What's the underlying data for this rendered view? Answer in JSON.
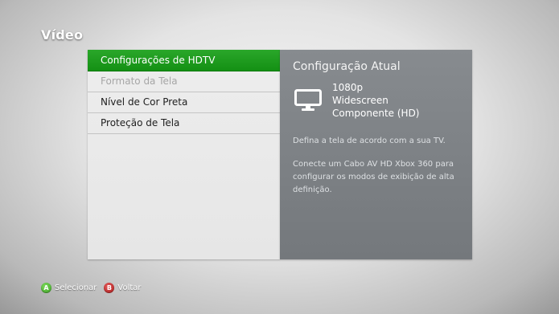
{
  "header": {
    "title": "Vídeo"
  },
  "menu": {
    "items": [
      {
        "label": "Configurações de HDTV",
        "state": "selected"
      },
      {
        "label": "Formato da Tela",
        "state": "disabled"
      },
      {
        "label": "Nível de Cor Preta",
        "state": "normal"
      },
      {
        "label": "Proteção de Tela",
        "state": "normal"
      }
    ]
  },
  "info": {
    "title": "Configuração Atual",
    "icon": "tv-icon",
    "current": {
      "resolution": "1080p",
      "aspect": "Widescreen",
      "connection": "Componente (HD)"
    },
    "description": "Defina a tela de acordo com a sua TV.",
    "hint": "Conecte um Cabo AV HD Xbox 360 para configurar os modos de exibição de alta definição."
  },
  "footer": {
    "buttons": [
      {
        "glyph": "A",
        "label": "Selecionar",
        "color": "#3a9a24"
      },
      {
        "glyph": "B",
        "label": "Voltar",
        "color": "#a81919"
      }
    ]
  },
  "colors": {
    "accent": "#1a9a1a",
    "info_panel": "#7e8286",
    "menu_panel": "#e9e9e9"
  }
}
